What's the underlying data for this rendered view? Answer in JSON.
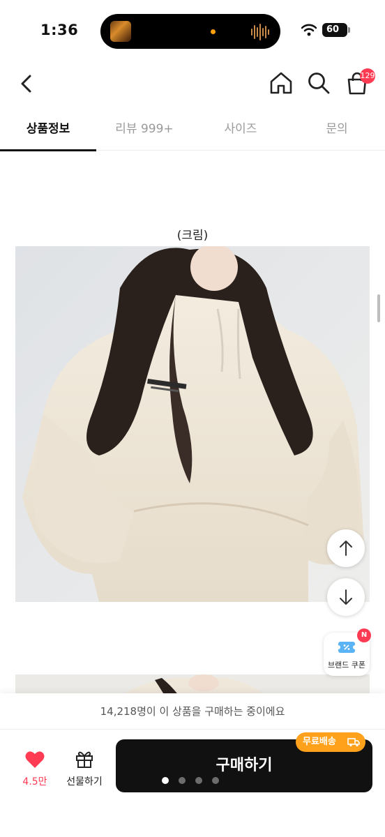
{
  "status_bar": {
    "time": "1:36",
    "battery": "60"
  },
  "header": {
    "cart_badge": "129",
    "icons": [
      "back-icon",
      "home-icon",
      "search-icon",
      "cart-icon"
    ]
  },
  "tabs": [
    {
      "label": "상품정보",
      "active": true
    },
    {
      "label": "리뷰 999+",
      "active": false
    },
    {
      "label": "사이즈",
      "active": false
    },
    {
      "label": "문의",
      "active": false
    }
  ],
  "product": {
    "caption": "(크림)"
  },
  "floating": {
    "coupon_label": "브랜드 쿠폰",
    "coupon_badge": "N"
  },
  "purchase_notice": "14,218명이 이 상품을 구매하는 중이에요",
  "bottom_bar": {
    "like_count": "4.5만",
    "gift_label": "선물하기",
    "buy_label": "구매하기",
    "free_shipping": "무료배송"
  },
  "colors": {
    "accent_red": "#ff3b53",
    "buy_button": "#111111",
    "shipping_badge": "#ffa11a"
  }
}
